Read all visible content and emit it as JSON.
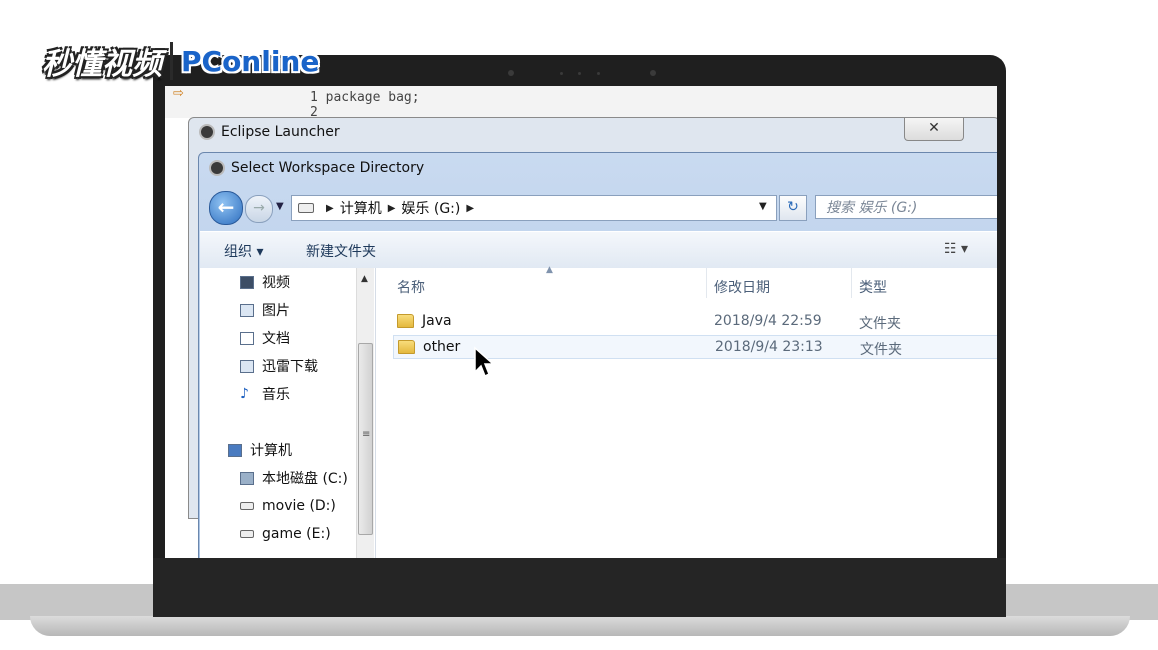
{
  "watermark": {
    "brand_cn": "秒懂视频",
    "brand_en": "PConline"
  },
  "eclipse_editor": {
    "lines": [
      "1  package  bag;",
      "2"
    ]
  },
  "launcher": {
    "title": "Eclipse Launcher",
    "close_glyph": "✕"
  },
  "dialog": {
    "title": "Select Workspace Directory",
    "address": {
      "segments": [
        "计算机",
        "娱乐 (G:)"
      ]
    },
    "search_placeholder": "搜索 娱乐 (G:)",
    "toolbar": {
      "organize": "组织 ▾",
      "new_folder": "新建文件夹",
      "view_icon": "☷ ▾"
    },
    "nav": {
      "items": [
        {
          "label": "视频",
          "icon": "video-library-icon"
        },
        {
          "label": "图片",
          "icon": "pictures-library-icon"
        },
        {
          "label": "文档",
          "icon": "documents-library-icon"
        },
        {
          "label": "迅雷下载",
          "icon": "download-library-icon"
        },
        {
          "label": "音乐",
          "icon": "music-library-icon"
        }
      ],
      "computer": "计算机",
      "drives": [
        {
          "label": "本地磁盘 (C:)",
          "icon": "local-disk-icon"
        },
        {
          "label": "movie (D:)",
          "icon": "drive-icon"
        },
        {
          "label": "game (E:)",
          "icon": "drive-icon"
        }
      ]
    },
    "columns": {
      "name": "名称",
      "modified": "修改日期",
      "type": "类型"
    },
    "files": [
      {
        "name": "Java",
        "modified": "2018/9/4 22:59",
        "type": "文件夹",
        "icon": "folder-icon"
      },
      {
        "name": "other",
        "modified": "2018/9/4 23:13",
        "type": "文件夹",
        "icon": "folder-icon",
        "hovered": true
      }
    ]
  },
  "colors": {
    "accent": "#1a64c9",
    "dialog_frame": "#a9c3e4",
    "folder": "#e4b83e"
  }
}
